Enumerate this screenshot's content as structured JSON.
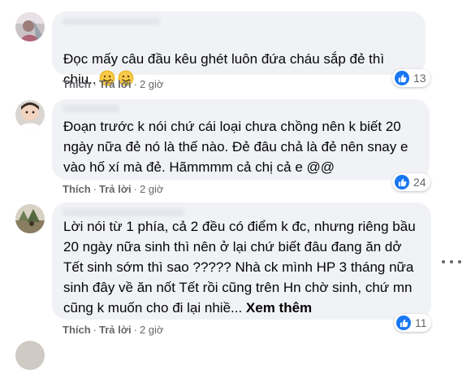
{
  "comments": [
    {
      "text": "Đọc mấy câu đầu kêu ghét luôn đứa cháu sắp đẻ thì\nchịu..",
      "emoji": [
        "smiling-face-emoji",
        "smiling-face-emoji"
      ],
      "like_label": "Thích",
      "reply_label": "Trả lời",
      "time": "2 giờ",
      "reaction_count": "13"
    },
    {
      "text": "Đoạn trước k nói chứ cái loại chưa chồng nên k biết 20\nngày nữa đẻ nó là thế nào. Đẻ đâu chả là đẻ nên snay e\nvào hố xí mà đẻ. Hãmmmm cả chị cả e @@",
      "like_label": "Thích",
      "reply_label": "Trả lời",
      "time": "2 giờ",
      "reaction_count": "24"
    },
    {
      "text": "Lời nói từ 1 phía, cả 2 đều có điểm k đc, nhưng riêng bầu\n20 ngày nữa sinh thì nên ở lại chứ biết đâu đang ăn dở\nTết sinh sớm thì sao ????? Nhà ck mình HP 3 tháng nữa\nsinh đây về ăn nốt Tết rồi cũng trên Hn chờ sinh, chứ mn\ncũng k muốn cho đi lại nhiề... ",
      "see_more": "Xem thêm",
      "like_label": "Thích",
      "reply_label": "Trả lời",
      "time": "2 giờ",
      "reaction_count": "11"
    }
  ],
  "separator": "·",
  "colors": {
    "bubble": "#f0f2f5",
    "meta": "#65676b",
    "like_blue": "#1877f2"
  },
  "icons": {
    "like": "thumbs-up-icon",
    "more": "more-options-icon"
  }
}
